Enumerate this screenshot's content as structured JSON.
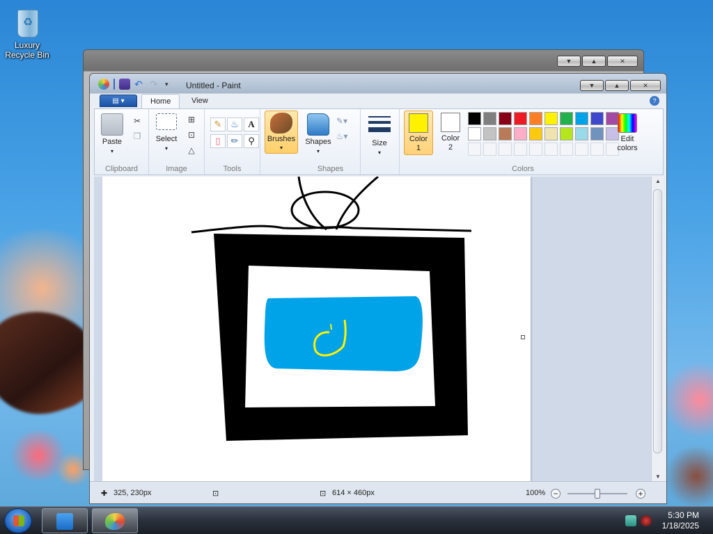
{
  "desktop": {
    "recycle_bin_label": "Luxury Recycle Bin"
  },
  "window": {
    "title": "Untitled - Paint",
    "minimize": "▼",
    "maximize": "▲",
    "close": "✕"
  },
  "ribbon": {
    "app_menu_label": "▤ ▾",
    "tabs": [
      "Home",
      "View"
    ],
    "help": "?",
    "clipboard": {
      "paste": "Paste",
      "group": "Clipboard"
    },
    "image": {
      "select": "Select",
      "group": "Image"
    },
    "tools": {
      "group": "Tools"
    },
    "brushes": {
      "label": "Brushes"
    },
    "shapes": {
      "label": "Shapes",
      "group": "Shapes"
    },
    "size": {
      "label": "Size"
    },
    "color1": {
      "label1": "Color",
      "label2": "1",
      "value": "#FFF200"
    },
    "color2": {
      "label1": "Color",
      "label2": "2",
      "value": "#FFFFFF"
    },
    "colors": {
      "group": "Colors",
      "edit": [
        "Edit",
        "colors"
      ],
      "palette": [
        "#000000",
        "#7F7F7F",
        "#880015",
        "#ED1C24",
        "#FF7F27",
        "#FFF200",
        "#22B14C",
        "#00A2E8",
        "#3F48CC",
        "#A349A4",
        "#FFFFFF",
        "#C3C3C3",
        "#B97A57",
        "#FFAEC9",
        "#FFC90E",
        "#EFE4B0",
        "#B5E61D",
        "#99D9EA",
        "#7092BE",
        "#C8BFE7",
        "",
        "",
        "",
        "",
        "",
        "",
        "",
        "",
        "",
        ""
      ]
    }
  },
  "drawing": {
    "frame_color": "#000000",
    "screen_color": "#00A2E8",
    "scribble_color": "#FFF200"
  },
  "status": {
    "cursor_pos": "325, 230px",
    "canvas_size": "614 × 460px",
    "zoom": "100%",
    "zoom_out": "−",
    "zoom_in": "+"
  },
  "taskbar": {
    "time": "5:30 PM",
    "date": "1/18/2025"
  }
}
